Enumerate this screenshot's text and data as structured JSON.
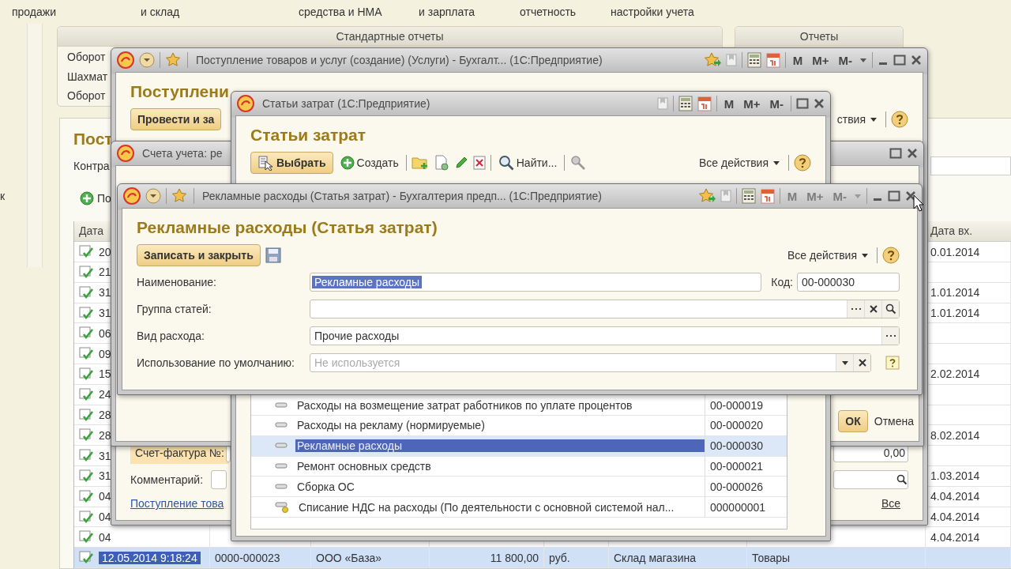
{
  "top_menu": [
    "продажи",
    "и склад",
    "средства и НМА",
    "и зарплата",
    "отчетность",
    "настройки учета"
  ],
  "sidebar_fragment": "к",
  "report_panels": [
    {
      "title": "Стандартные отчеты",
      "items": [
        "Оборот",
        "Шахмат",
        "Оборот"
      ]
    },
    {
      "title": "Отчеты"
    }
  ],
  "document_list": {
    "title": "Пост",
    "filter_label": "Контра",
    "add_button": "По",
    "columns": [
      "Дата",
      "Дата вх."
    ],
    "rows": [
      {
        "date": "20",
        "date_in": "0.01.2014",
        "selected": false
      },
      {
        "date": "21",
        "date_in": "",
        "selected": false
      },
      {
        "date": "31",
        "date_in": "1.01.2014",
        "selected": false
      },
      {
        "date": "31",
        "date_in": "1.01.2014",
        "selected": false
      },
      {
        "date": "06",
        "date_in": "",
        "selected": false
      },
      {
        "date": "09",
        "date_in": "",
        "selected": false
      },
      {
        "date": "15",
        "date_in": "2.02.2014",
        "selected": false
      },
      {
        "date": "24",
        "date_in": "",
        "selected": false
      },
      {
        "date": "28",
        "date_in": "",
        "selected": false
      },
      {
        "date": "28",
        "date_in": "8.02.2014",
        "selected": false
      },
      {
        "date": "31",
        "date_in": "",
        "selected": false
      },
      {
        "date": "31",
        "date_in": "1.03.2014",
        "selected": false
      },
      {
        "date": "04",
        "date_in": "4.04.2014",
        "selected": false
      },
      {
        "date": "04",
        "date_in": "4.04.2014",
        "selected": false
      },
      {
        "date": "04",
        "date_in": "4.04.2014",
        "selected": false
      },
      {
        "date": "12.05.2014 9:18:24",
        "column_2": "0000-000023",
        "column_3": "ООО «База»",
        "column_4": "11 800,00",
        "column_5": "руб.",
        "column_6": "Склад магазина",
        "column_7": "Товары",
        "date_in": "",
        "selected": true
      }
    ]
  },
  "purchase_window": {
    "title": "Поступление товаров и услуг (создание) (Услуги) - Бухгалт... (1С:Предприятие)",
    "memory_buttons": [
      "M",
      "M+",
      "M-"
    ],
    "memory_disabled": false,
    "heading": "Поступлени",
    "post_button": "Провести и за",
    "actions_menu": "ствия",
    "invoice_label": "Счет-фактура №:",
    "amount": "0,00",
    "comment_label": "Комментарий:",
    "link": "Поступление това",
    "all_link": "Все"
  },
  "accounts_window": {
    "title": "Счета учета: ре",
    "ok_button": "ОК",
    "cancel_button": "Отмена"
  },
  "expense_items_window": {
    "title": "Статьи затрат (1С:Предприятие)",
    "memory_buttons": [
      "M",
      "M+",
      "M-"
    ],
    "memory_disabled": false,
    "heading": "Статьи затрат",
    "select_button": "Выбрать",
    "create_button": "Создать",
    "find_button": "Найти...",
    "all_actions": "Все действия",
    "rows": [
      {
        "kind": "item",
        "name": "Расходы на возмещение затрат работников по уплате процентов",
        "code": "00-000019",
        "selected": false
      },
      {
        "kind": "item",
        "name": "Расходы на рекламу (нормируемые)",
        "code": "00-000020",
        "selected": false
      },
      {
        "kind": "item",
        "name": "Рекламные расходы",
        "code": "00-000030",
        "selected": true
      },
      {
        "kind": "item",
        "name": "Ремонт основных средств",
        "code": "00-000021",
        "selected": false
      },
      {
        "kind": "item",
        "name": "Сборка ОС",
        "code": "00-000026",
        "selected": false
      },
      {
        "kind": "predefined",
        "name": "Списание НДС на расходы (По деятельности с основной системой нал...",
        "code": "000000001",
        "selected": false
      }
    ]
  },
  "expense_item_form": {
    "title": "Рекламные расходы (Статья затрат) - Бухгалтерия предп... (1С:Предприятие)",
    "memory_buttons": [
      "M",
      "M+",
      "M-"
    ],
    "memory_disabled": true,
    "heading": "Рекламные расходы (Статья затрат)",
    "save_close_button": "Записать и закрыть",
    "all_actions": "Все действия",
    "code_label": "Код:",
    "code": "00-000030",
    "fields": [
      {
        "kind": "text",
        "label": "Наименование:",
        "value": "Рекламные расходы",
        "text_selected": true
      },
      {
        "kind": "lookup",
        "label": "Группа статей:"
      },
      {
        "kind": "choice",
        "label": "Вид расхода:",
        "value": "Прочие расходы"
      },
      {
        "kind": "dropdown",
        "label": "Использование по умолчанию:",
        "placeholder": "Не используется"
      }
    ]
  }
}
